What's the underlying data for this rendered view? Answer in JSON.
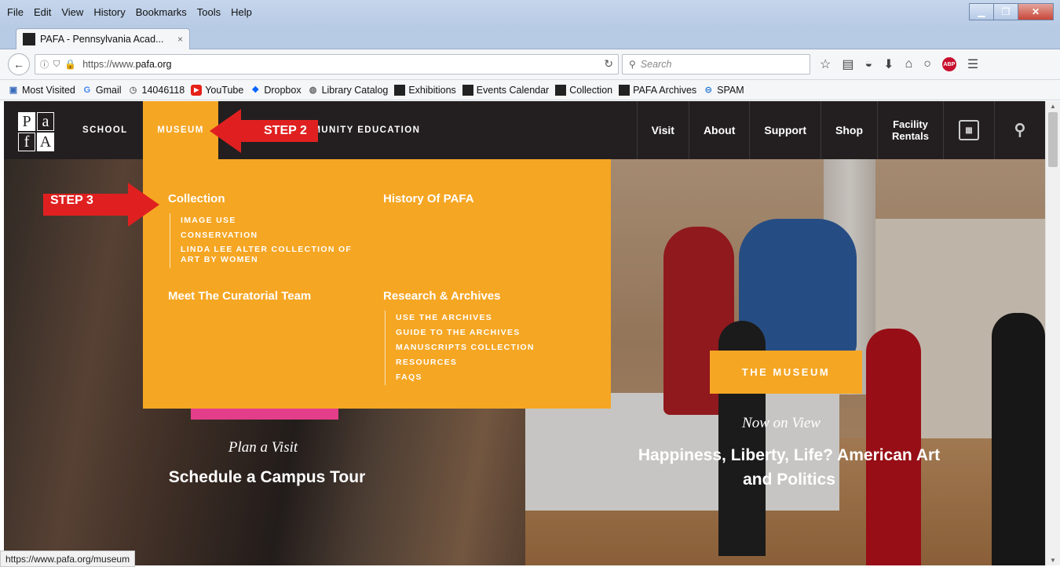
{
  "browser": {
    "menu": [
      "File",
      "Edit",
      "View",
      "History",
      "Bookmarks",
      "Tools",
      "Help"
    ],
    "tab_title": "PAFA - Pennsylvania Acad...",
    "tab_close": "×",
    "new_tab": "+",
    "url_prefix": "https://www.",
    "url_domain": "pafa.org",
    "search_placeholder": "Search",
    "bookmarks": [
      {
        "label": "Most Visited",
        "icon": "most-visited-icon"
      },
      {
        "label": "Gmail",
        "icon": "google-icon"
      },
      {
        "label": "14046118",
        "icon": "clock-icon"
      },
      {
        "label": "YouTube",
        "icon": "youtube-icon"
      },
      {
        "label": "Dropbox",
        "icon": "dropbox-icon"
      },
      {
        "label": "Library Catalog",
        "icon": "globe-icon"
      },
      {
        "label": "Exhibitions",
        "icon": "pafa-icon"
      },
      {
        "label": "Events Calendar",
        "icon": "pafa-icon"
      },
      {
        "label": "Collection",
        "icon": "pafa-icon"
      },
      {
        "label": "PAFA Archives",
        "icon": "pafa-icon"
      },
      {
        "label": "SPAM",
        "icon": "spam-icon"
      }
    ],
    "status_url": "https://www.pafa.org/museum"
  },
  "site": {
    "nav_left": {
      "school": "SCHOOL",
      "museum": "MUSEUM",
      "community": "OMMUNITY EDUCATION"
    },
    "nav_right": {
      "visit": "Visit",
      "about": "About",
      "support": "Support",
      "shop": "Shop",
      "facility_1": "Facility",
      "facility_2": "Rentals"
    },
    "dropdown": {
      "collection": {
        "title": "Collection",
        "items": [
          "IMAGE USE",
          "CONSERVATION",
          "LINDA LEE ALTER COLLECTION OF ART BY WOMEN"
        ]
      },
      "curatorial": {
        "title": "Meet The Curatorial Team"
      },
      "history": {
        "title": "History Of PAFA"
      },
      "research": {
        "title": "Research & Archives",
        "items": [
          "USE THE ARCHIVES",
          "GUIDE TO THE ARCHIVES",
          "MANUSCRIPTS COLLECTION",
          "RESOURCES",
          "FAQS"
        ]
      }
    },
    "hero": {
      "museum_badge": "THE MUSEUM",
      "now_on_view": "Now on View",
      "exhibition_line1": "Happiness, Liberty, Life? American Art",
      "exhibition_line2": "and Politics",
      "plan_visit": "Plan a Visit",
      "campus_tour": "Schedule a Campus Tour"
    }
  },
  "annotations": {
    "step2": "STEP 2",
    "step3": "STEP 3"
  },
  "colors": {
    "accent": "#f5a623",
    "nav_bg": "#231f20",
    "arrow": "#e02020",
    "pink": "#e43d8a"
  }
}
